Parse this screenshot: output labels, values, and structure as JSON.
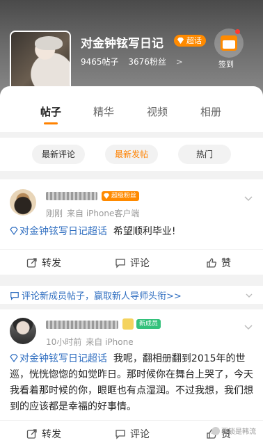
{
  "header": {
    "title": "对金钟铉写日记",
    "badge": "超话",
    "posts": "9465帖子",
    "fans": "3676粉丝",
    "stats_arrow": ">",
    "signin_label": "签到"
  },
  "tabs": [
    {
      "label": "帖子",
      "active": true
    },
    {
      "label": "精华",
      "active": false
    },
    {
      "label": "视频",
      "active": false
    },
    {
      "label": "相册",
      "active": false
    }
  ],
  "sort": [
    {
      "label": "最新评论",
      "active": false
    },
    {
      "label": "最新发帖",
      "active": true
    },
    {
      "label": "热门",
      "active": false
    }
  ],
  "posts": [
    {
      "badge": "超级粉丝",
      "time": "刚刚",
      "source": "来自 iPhone客户端",
      "topic": "对金钟铉写日记超话",
      "text": "希望顺利毕业!",
      "repost": "转发",
      "comment": "评论",
      "like": "赞"
    },
    {
      "badge": "新成员",
      "time": "10小时前",
      "source": "来自 iPhone",
      "topic": "对金钟铉写日记超话",
      "text": "我呢，翻相册翻到2015年的世巡，恍恍惚惚的如觉昨日。那时候你在舞台上哭了，今天我看着那时候的你，眼眶也有点湿润。不过我想，我们想到的应该都是幸福的好事情。",
      "repost": "转发",
      "comment": "评论",
      "like": "赞"
    }
  ],
  "banner": {
    "text": "评论新成员帖子，赢取新人导师头衔>>"
  },
  "watermark": "要锁是韩流",
  "colors": {
    "accent": "#ff8200",
    "link": "#2f6ec0"
  }
}
